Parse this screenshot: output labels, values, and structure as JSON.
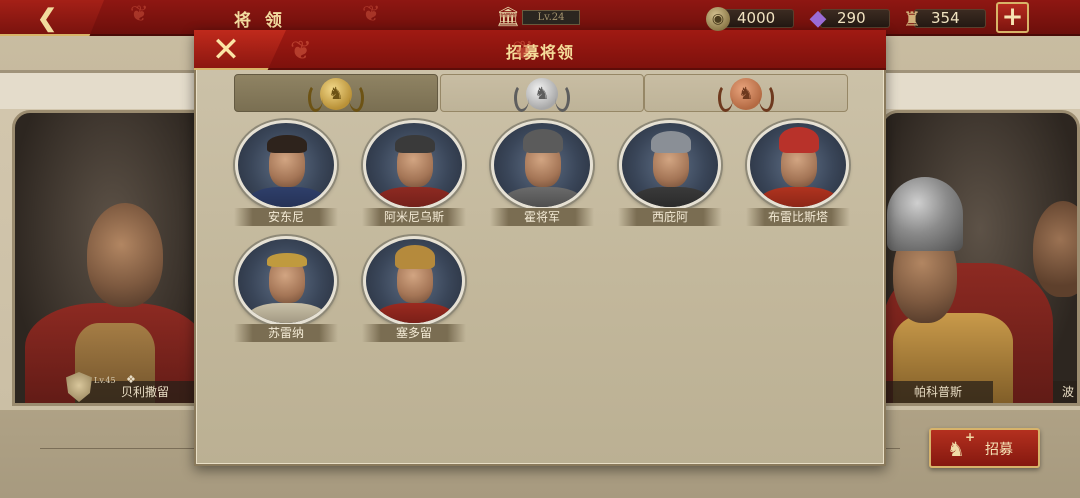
{
  "topbar": {
    "title": "将 领",
    "level": "Lv.24",
    "resources": [
      {
        "icon": "coin-icon",
        "value": "4000"
      },
      {
        "icon": "gem-icon",
        "value": "290"
      },
      {
        "icon": "scroll-icon",
        "value": "354"
      }
    ],
    "plus_label": "+"
  },
  "background": {
    "left_hero_level": "Lv.45",
    "left_hero_name": "贝利撒留",
    "right_hero_name": "帕科普斯",
    "far_right_hero_name": "波",
    "recruit_label": "招募"
  },
  "modal": {
    "title": "招募将领",
    "close_label": "✕",
    "tabs": [
      {
        "tier": "gold",
        "icon": "gold-laurel-helmet-icon",
        "active": true
      },
      {
        "tier": "silver",
        "icon": "silver-laurel-helmet-icon",
        "active": false
      },
      {
        "tier": "bronze",
        "icon": "bronze-laurel-helmet-icon",
        "active": false
      }
    ],
    "heroes": [
      {
        "name": "安东尼"
      },
      {
        "name": "阿米尼乌斯"
      },
      {
        "name": "霍将军"
      },
      {
        "name": "西庇阿"
      },
      {
        "name": "布雷比斯塔"
      },
      {
        "name": "苏雷纳"
      },
      {
        "name": "塞多留"
      }
    ]
  },
  "colors": {
    "accent_red": "#8f1712",
    "gold_trim": "#d8b468",
    "parchment": "#c8bda3"
  }
}
